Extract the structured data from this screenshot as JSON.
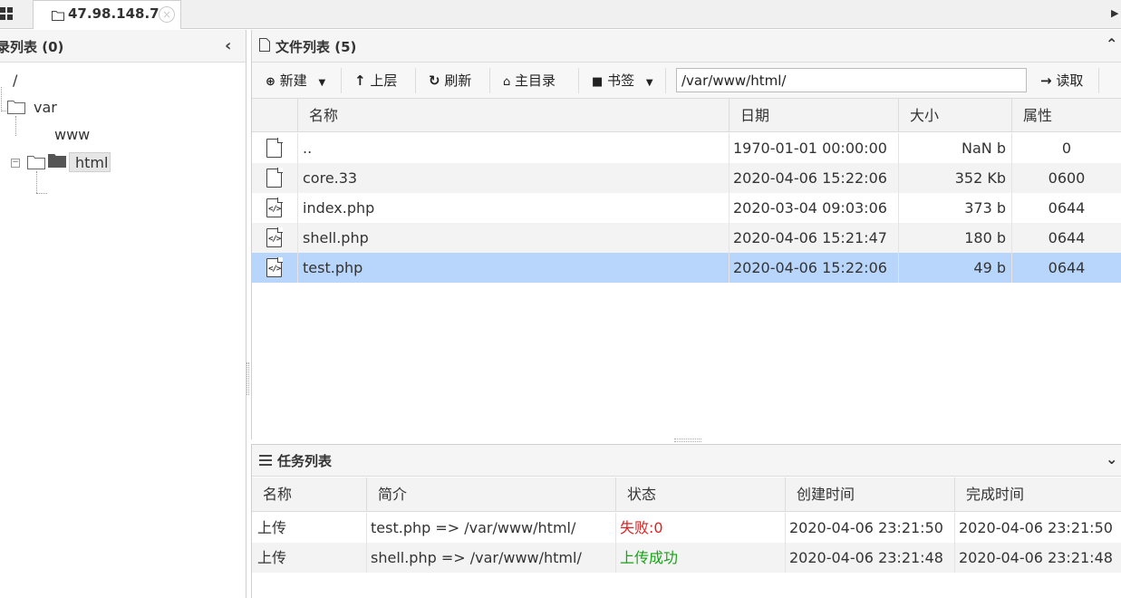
{
  "tab": {
    "label": "47.98.148.7",
    "close": "⊗"
  },
  "left_panel": {
    "title": "录列表 (0)",
    "tree": [
      {
        "label": "/"
      },
      {
        "label": "var"
      },
      {
        "label": "www"
      },
      {
        "label": "html"
      }
    ]
  },
  "file_panel": {
    "title": "文件列表 (5)",
    "toolbar": {
      "new": "新建",
      "up": "上层",
      "refresh": "刷新",
      "home": "主目录",
      "bookmark": "书签",
      "path": "/var/www/html/",
      "read": "读取"
    },
    "columns": [
      "名称",
      "日期",
      "大小",
      "属性"
    ],
    "rows": [
      {
        "name": "..",
        "date": "1970-01-01 00:00:00",
        "size": "NaN b",
        "attr": "0",
        "icon": "file-icon"
      },
      {
        "name": "core.33",
        "date": "2020-04-06 15:22:06",
        "size": "352 Kb",
        "attr": "0600",
        "icon": "file-icon"
      },
      {
        "name": "index.php",
        "date": "2020-03-04 09:03:06",
        "size": "373 b",
        "attr": "0644",
        "icon": "code-file-icon"
      },
      {
        "name": "shell.php",
        "date": "2020-04-06 15:21:47",
        "size": "180 b",
        "attr": "0644",
        "icon": "code-file-icon"
      },
      {
        "name": "test.php",
        "date": "2020-04-06 15:22:06",
        "size": "49 b",
        "attr": "0644",
        "icon": "code-file-icon"
      }
    ]
  },
  "task_panel": {
    "title": "任务列表",
    "columns": [
      "名称",
      "简介",
      "状态",
      "创建时间",
      "完成时间"
    ],
    "rows": [
      {
        "name": "上传",
        "desc": "test.php => /var/www/html/",
        "status": "失败:0",
        "created": "2020-04-06 23:21:50",
        "done": "2020-04-06 23:21:50"
      },
      {
        "name": "上传",
        "desc": "shell.php => /var/www/html/",
        "status": "上传成功",
        "created": "2020-04-06 23:21:48",
        "done": "2020-04-06 23:21:48"
      }
    ]
  },
  "colors": {
    "selected_row": "#b8d6fb",
    "fail": "#e02020",
    "success": "#17a217"
  }
}
